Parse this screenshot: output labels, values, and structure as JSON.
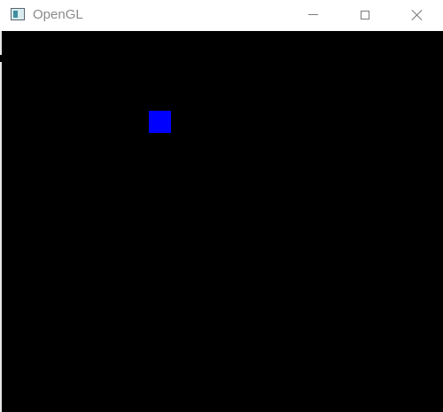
{
  "window": {
    "title": "OpenGL",
    "controls": {
      "minimize": "minimize-icon",
      "maximize": "maximize-icon",
      "close": "close-icon"
    }
  },
  "canvas": {
    "background_color": "#000000",
    "square_color": "#0000ff"
  }
}
